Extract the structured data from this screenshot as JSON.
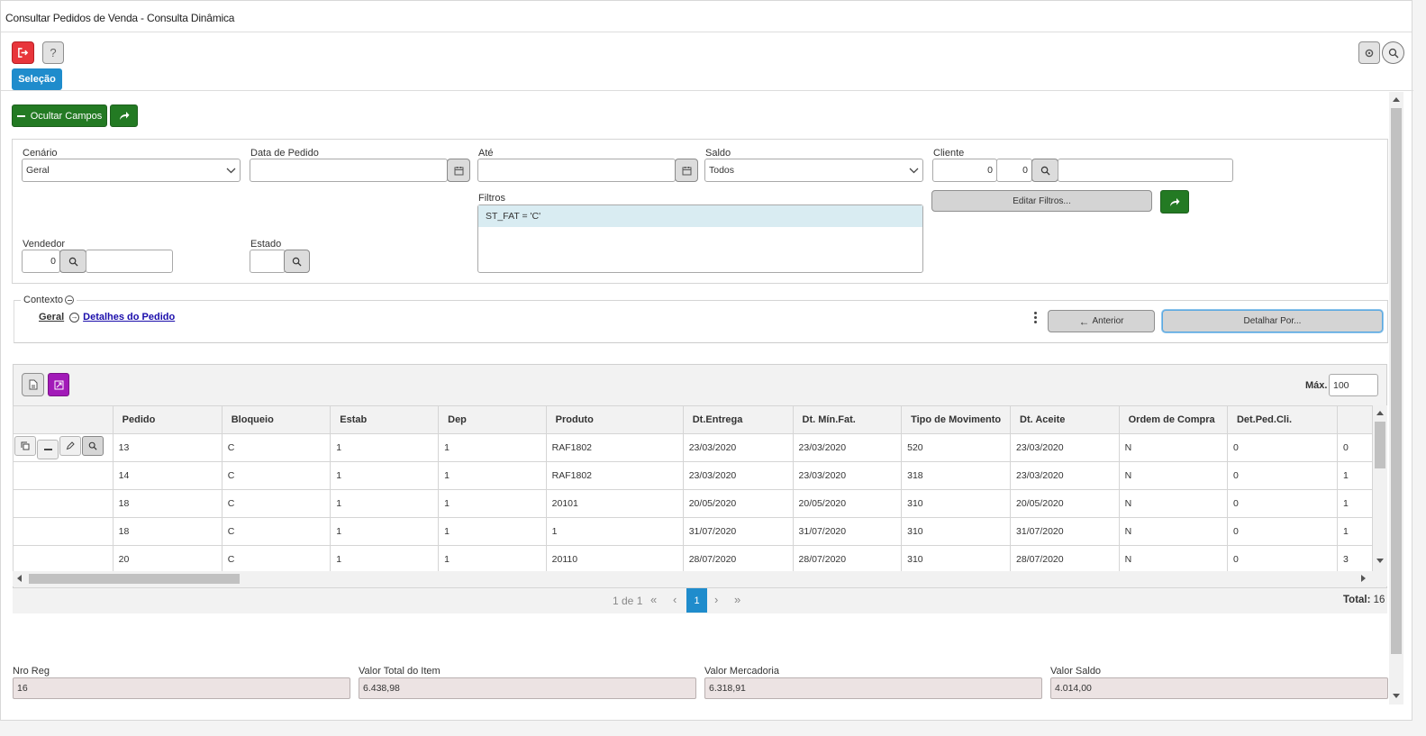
{
  "window": {
    "title": "Consultar Pedidos de Venda - Consulta Dinâmica"
  },
  "toolbar": {
    "tab_selecao": "Seleção",
    "hide_fields_label": "Ocultar Campos"
  },
  "filters": {
    "cenario_label": "Cenário",
    "cenario_value": "Geral",
    "data_pedido_label": "Data de Pedido",
    "data_pedido_value": "",
    "ate_label": "Até",
    "ate_value": "",
    "saldo_label": "Saldo",
    "saldo_value": "Todos",
    "cliente_label": "Cliente",
    "cliente_code1": "0",
    "cliente_code2": "0",
    "cliente_name": "",
    "filtros_label": "Filtros",
    "filtros_items": [
      "ST_FAT = 'C'"
    ],
    "edit_filters_label": "Editar Filtros...",
    "vendedor_label": "Vendedor",
    "vendedor_code": "0",
    "vendedor_name": "",
    "estado_label": "Estado",
    "estado_value": ""
  },
  "context": {
    "label": "Contexto",
    "crumb_root": "Geral",
    "crumb_current": "Detalhes do Pedido",
    "prev_label": "Anterior",
    "drill_label": "Detalhar Por..."
  },
  "grid": {
    "max_label": "Máx.",
    "max_value": "100",
    "columns": [
      "Pedido",
      "Bloqueio",
      "Estab",
      "Dep",
      "Produto",
      "Dt.Entrega",
      "Dt. Mín.Fat.",
      "Tipo de Movimento",
      "Dt. Aceite",
      "Ordem de Compra",
      "Det.Ped.Cli.",
      ""
    ],
    "rows": [
      [
        "13",
        "C",
        "1",
        "1",
        "RAF1802",
        "23/03/2020",
        "23/03/2020",
        "520",
        "23/03/2020",
        "N",
        "0",
        "0"
      ],
      [
        "14",
        "C",
        "1",
        "1",
        "RAF1802",
        "23/03/2020",
        "23/03/2020",
        "318",
        "23/03/2020",
        "N",
        "0",
        "1"
      ],
      [
        "18",
        "C",
        "1",
        "1",
        "20101",
        "20/05/2020",
        "20/05/2020",
        "310",
        "20/05/2020",
        "N",
        "0",
        "1"
      ],
      [
        "18",
        "C",
        "1",
        "1",
        "1",
        "31/07/2020",
        "31/07/2020",
        "310",
        "31/07/2020",
        "N",
        "0",
        "1"
      ],
      [
        "20",
        "C",
        "1",
        "1",
        "20110",
        "28/07/2020",
        "28/07/2020",
        "310",
        "28/07/2020",
        "N",
        "0",
        "3"
      ]
    ],
    "pager_info": "1 de 1",
    "current_page": "1",
    "total_label": "Total:",
    "total_value": "16"
  },
  "summary": {
    "nro_reg_label": "Nro Reg",
    "nro_reg_value": "16",
    "valor_total_item_label": "Valor Total do Item",
    "valor_total_item_value": "6.438,98",
    "valor_mercadoria_label": "Valor Mercadoria",
    "valor_mercadoria_value": "6.318,91",
    "valor_saldo_label": "Valor Saldo",
    "valor_saldo_value": "4.014,00"
  },
  "colors": {
    "exit_red": "#e8353b",
    "tab_blue": "#1f8ccc",
    "green": "#237a23",
    "purple": "#a21ab8",
    "pager_blue": "#1f8ccc",
    "summary_bg": "#ece3e3"
  }
}
